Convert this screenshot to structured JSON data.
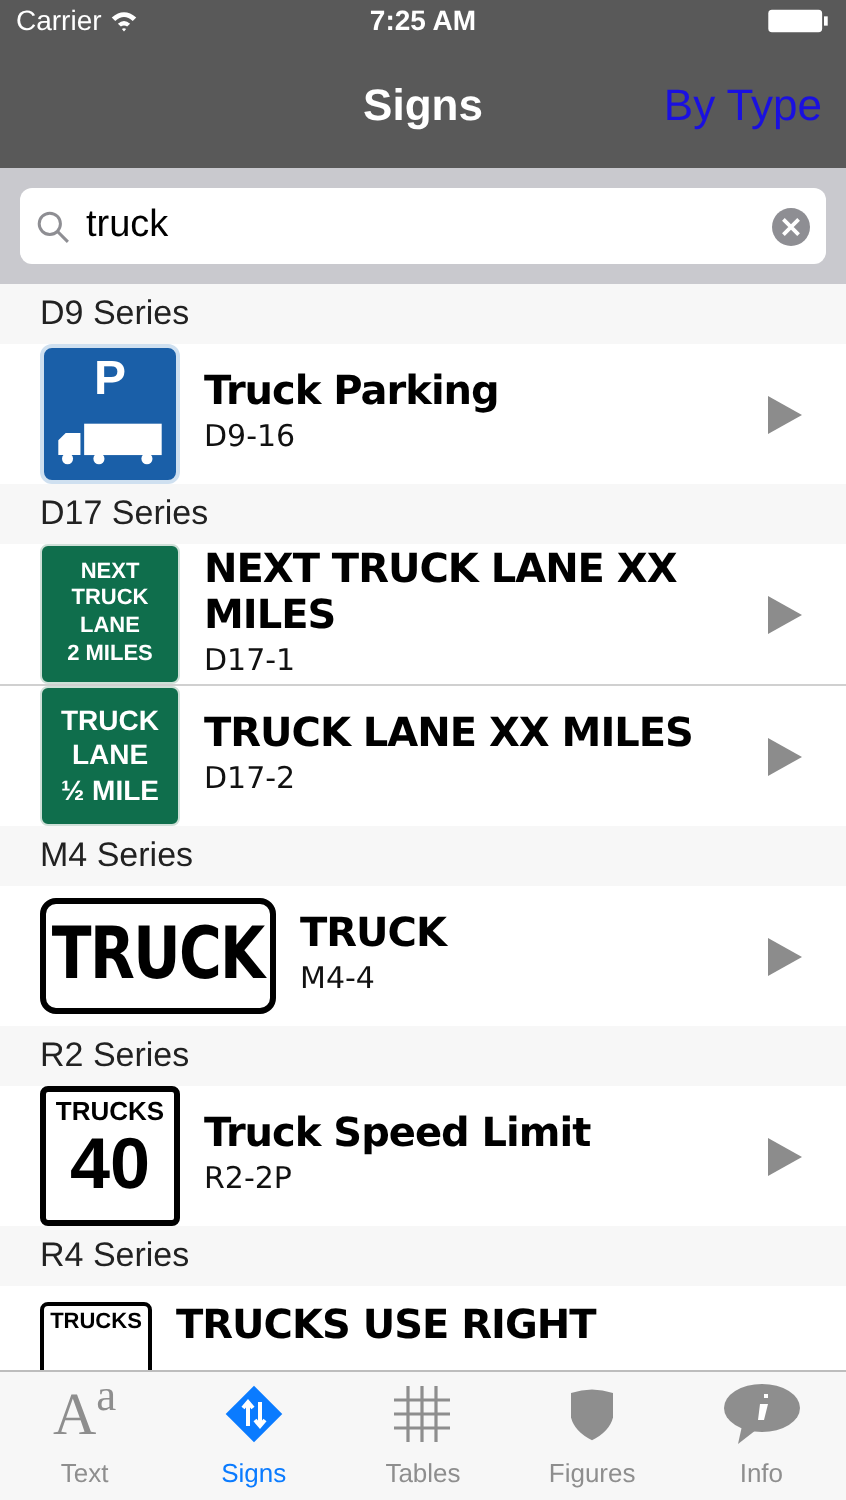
{
  "status_bar": {
    "carrier": "Carrier",
    "time": "7:25 AM"
  },
  "nav": {
    "title": "Signs",
    "right_button": "By Type"
  },
  "search": {
    "value": "truck"
  },
  "sections": [
    {
      "header": "D9 Series",
      "rows": [
        {
          "title": "Truck Parking",
          "code": "D9-16",
          "sign": {
            "kind": "parking",
            "lines": [
              "P"
            ]
          }
        }
      ]
    },
    {
      "header": "D17 Series",
      "rows": [
        {
          "title": "NEXT TRUCK LANE XX MILES",
          "code": "D17-1",
          "sign": {
            "kind": "green",
            "lines": [
              "NEXT",
              "TRUCK",
              "LANE",
              "2 MILES"
            ]
          }
        },
        {
          "title": "TRUCK LANE XX MILES",
          "code": "D17-2",
          "sign": {
            "kind": "green",
            "lines": [
              "TRUCK",
              "LANE",
              "½ MILE"
            ]
          }
        }
      ]
    },
    {
      "header": "M4 Series",
      "rows": [
        {
          "title": "TRUCK",
          "code": "M4-4",
          "sign": {
            "kind": "wide",
            "lines": [
              "TRUCK"
            ]
          }
        }
      ]
    },
    {
      "header": "R2 Series",
      "rows": [
        {
          "title": "Truck Speed Limit",
          "code": "R2-2P",
          "sign": {
            "kind": "speed",
            "lines": [
              "TRUCKS",
              "40"
            ]
          }
        }
      ]
    },
    {
      "header": "R4 Series",
      "rows": [
        {
          "title": "TRUCKS USE RIGHT",
          "sign": {
            "kind": "white",
            "lines": [
              "TRUCKS"
            ]
          }
        }
      ]
    }
  ],
  "tabs": [
    {
      "label": "Text",
      "kind": "text",
      "glyph": "A$^{a}$",
      "selected": false
    },
    {
      "label": "Signs",
      "kind": "signs",
      "selected": true
    },
    {
      "label": "Tables",
      "kind": "tables",
      "selected": false
    },
    {
      "label": "Figures",
      "kind": "figures",
      "selected": false
    },
    {
      "label": "Info",
      "kind": "info",
      "selected": false
    }
  ]
}
